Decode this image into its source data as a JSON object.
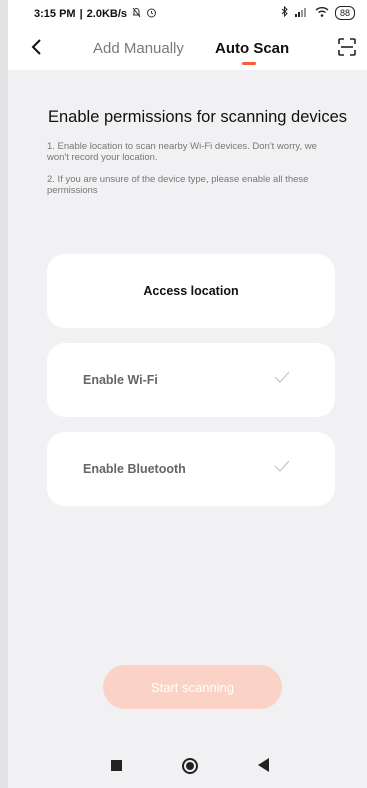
{
  "status_bar": {
    "time": "3:15 PM",
    "separator": "|",
    "network_speed": "2.0KB/s",
    "battery": "88"
  },
  "header": {
    "tabs": [
      {
        "label": "Add Manually",
        "active": false
      },
      {
        "label": "Auto Scan",
        "active": true
      }
    ]
  },
  "main": {
    "title": "Enable permissions for scanning devices",
    "hints": [
      "1. Enable location to scan nearby Wi-Fi devices. Don't worry, we won't record your location.",
      "2. If you are unsure of the device type, please enable all these permissions"
    ],
    "permissions": [
      {
        "label": "Access location",
        "enabled": false
      },
      {
        "label": "Enable Wi-Fi",
        "enabled": true
      },
      {
        "label": "Enable Bluetooth",
        "enabled": true
      }
    ],
    "start_button": "Start scanning"
  },
  "colors": {
    "accent": "#ff5a36",
    "start_button_disabled": "#fbd2c6",
    "background": "#f1f1f3"
  },
  "icons": {
    "back": "chevron-left-icon",
    "scan": "scan-frame-icon",
    "check": "check-icon"
  }
}
